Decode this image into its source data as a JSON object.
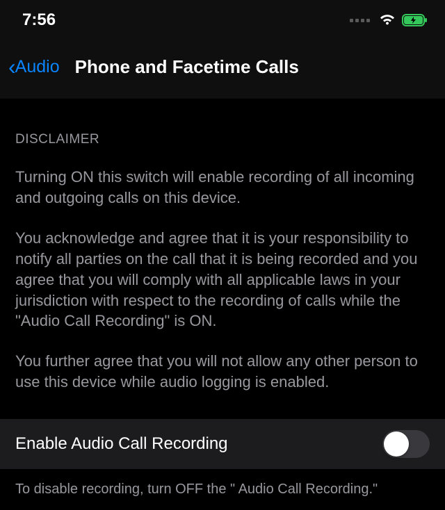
{
  "status_bar": {
    "time": "7:56"
  },
  "nav": {
    "back_label": "Audio",
    "title": "Phone and Facetime Calls"
  },
  "disclaimer": {
    "heading": "DISCLAIMER",
    "para1": "Turning ON this switch will enable recording of all incoming and outgoing calls on this device.",
    "para2": "You acknowledge and agree that it is your responsibility to notify all parties on the call that it is being recorded and you agree that you will comply with all applicable laws in your jurisdiction with respect to the recording of calls while the \"Audio Call Recording\" is ON.",
    "para3": "You further agree that you will not allow any other person to use this device while audio logging is enabled."
  },
  "toggle": {
    "label": "Enable Audio Call Recording",
    "enabled": false
  },
  "footer": {
    "text": "To disable recording, turn OFF the \" Audio Call Recording.\""
  }
}
